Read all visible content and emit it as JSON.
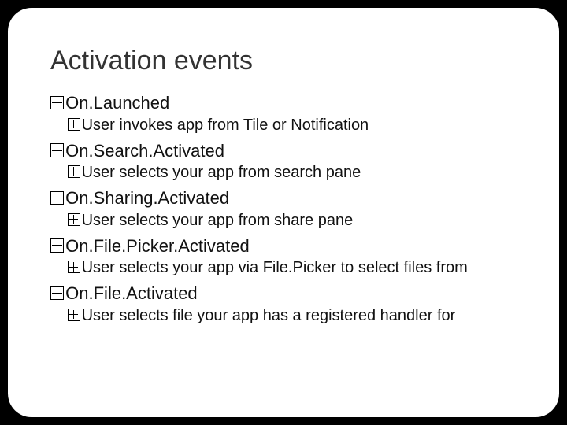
{
  "title": "Activation events",
  "events": [
    {
      "name": "On.Launched",
      "desc": "User invokes app from Tile or Notification"
    },
    {
      "name": "On.Search.Activated",
      "desc": "User selects your app from search pane"
    },
    {
      "name": "On.Sharing.Activated",
      "desc": "User selects your app from share pane"
    },
    {
      "name": "On.File.Picker.Activated",
      "desc": "User selects your app via File.Picker to select files from"
    },
    {
      "name": "On.File.Activated",
      "desc": "User selects file your app has a registered handler for"
    }
  ]
}
